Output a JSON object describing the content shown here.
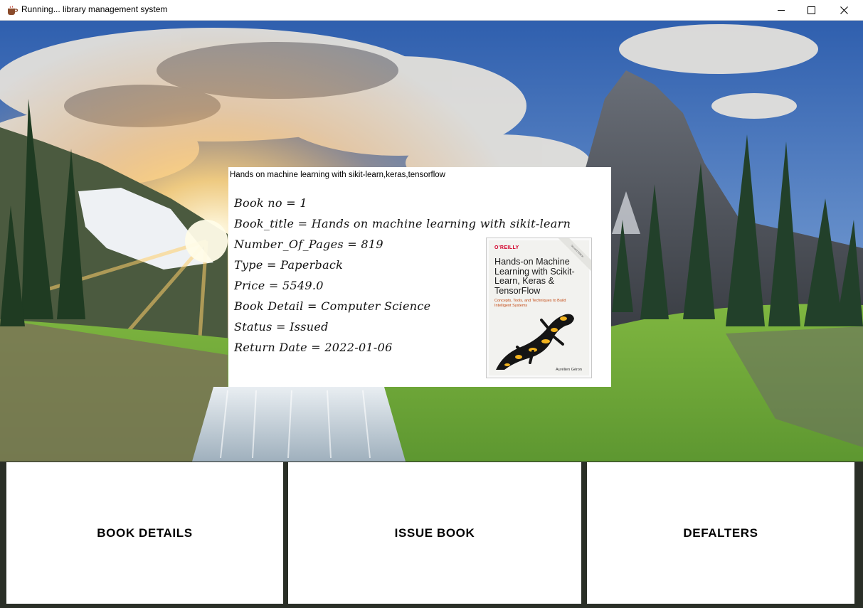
{
  "window": {
    "title": "Running... library management system",
    "icon": "coffee-cup-icon",
    "controls": [
      "minimize-icon",
      "maximize-icon",
      "close-icon"
    ]
  },
  "background": {
    "description_icon": "mountain-landscape-background"
  },
  "book_panel": {
    "heading": "Hands on machine learning with sikit-learn,keras,tensorflow",
    "fields": [
      "Book no  = 1",
      "Book_title  = Hands on machine learning with sikit-learn",
      "Number_Of_Pages  = 819",
      "Type  = Paperback",
      "Price  = 5549.0",
      "Book Detail  = Computer Science",
      "Status  = Issued",
      "Return Date = 2022-01-06"
    ],
    "cover": {
      "publisher": "O'REILLY",
      "title": "Hands-on Machine Learning with Scikit-Learn, Keras & TensorFlow",
      "subtitle": "Concepts, Tools, and Techniques to Build Intelligent Systems",
      "edition_band": "Second Edition",
      "author": "Aurélien Géron"
    }
  },
  "menu": {
    "book_details": "BOOK DETAILS",
    "issue_book": "ISSUE BOOK",
    "defalters": "DEFALTERS"
  },
  "colors": {
    "panel_bg": "#ffffff",
    "button_bg": "#ffffff",
    "oreilly_red": "#d3002a"
  }
}
